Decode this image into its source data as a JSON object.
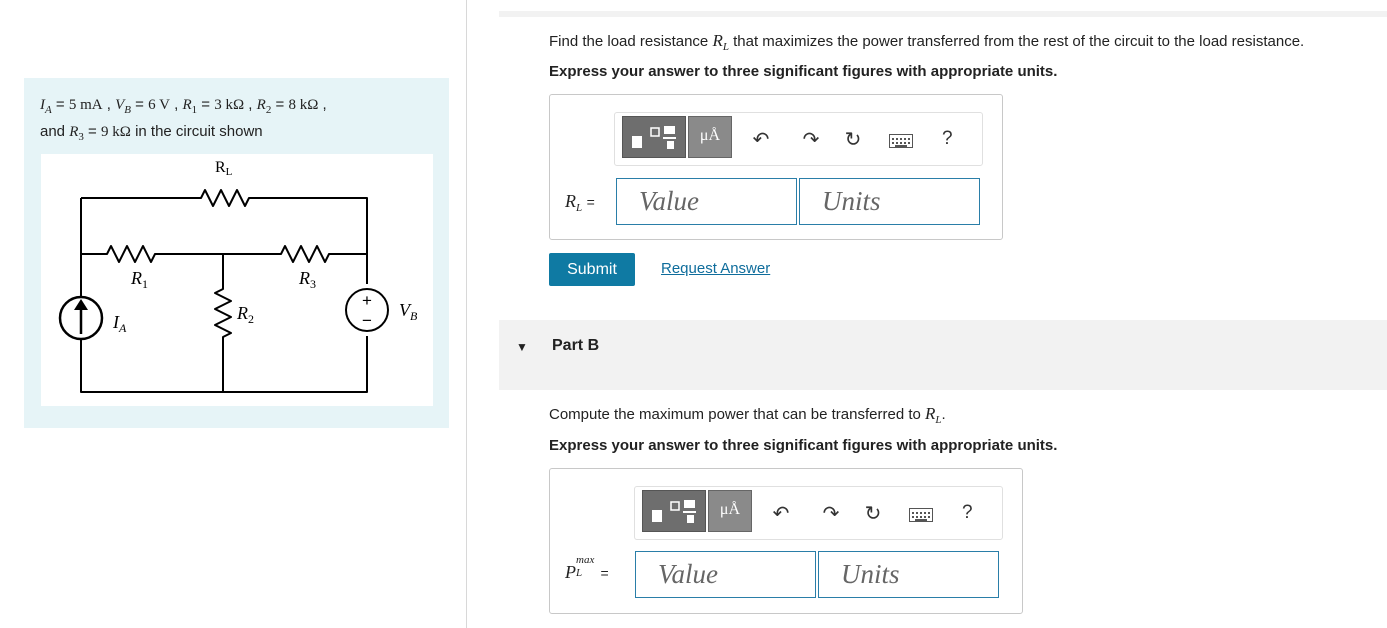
{
  "problem": {
    "given_line1": "I_A = 5 mA , V_B = 6 V , R_1 = 3 kΩ , R_2 = 8 kΩ ,",
    "given_line2": "and R_3 = 9 kΩ in the circuit shown",
    "parts": {
      "IA": "I",
      "IA_sub": "A",
      "IA_val": "5 mA",
      "VB": "V",
      "VB_sub": "B",
      "VB_val": "6 V",
      "R1": "R",
      "R1_sub": "1",
      "R1_val": "3 kΩ",
      "R2": "R",
      "R2_sub": "2",
      "R2_val": "8 kΩ",
      "R3": "R",
      "R3_sub": "3",
      "R3_val": "9 kΩ",
      "and": "and",
      "tail": "in the circuit shown"
    },
    "circuit_labels": {
      "RL": "R",
      "RL_sub": "L",
      "R1": "R",
      "R1_sub": "1",
      "R3": "R",
      "R3_sub": "3",
      "R2": "R",
      "R2_sub": "2",
      "IA": "I",
      "IA_sub": "A",
      "VB": "V",
      "VB_sub": "B",
      "plus": "+",
      "minus": "−"
    }
  },
  "part_a": {
    "question_pre": "Find the load resistance",
    "question_var": "R",
    "question_sub": "L",
    "question_post": "that maximizes the power transferred from the rest of the circuit to the load resistance.",
    "instruction": "Express your answer to three significant figures with appropriate units.",
    "var_label": "R",
    "var_sub": "L",
    "eq": "=",
    "value_placeholder": "Value",
    "units_placeholder": "Units",
    "submit_label": "Submit",
    "request_label": "Request Answer"
  },
  "part_b": {
    "title": "Part B",
    "question_pre": "Compute the maximum power that can be transferred to",
    "question_var": "R",
    "question_sub": "L",
    "question_post": ".",
    "instruction": "Express your answer to three significant figures with appropriate units.",
    "var_label": "P",
    "var_sup": "max",
    "var_sub": "L",
    "eq": "=",
    "value_placeholder": "Value",
    "units_placeholder": "Units"
  },
  "toolbar": {
    "units_button": "μÅ",
    "help": "?",
    "icons": [
      "templates-icon",
      "units-icon",
      "undo-icon",
      "redo-icon",
      "reset-icon",
      "keyboard-icon",
      "help-icon"
    ]
  },
  "colors": {
    "accent": "#0f7aa3",
    "panel": "#e6f4f7",
    "field_border": "#2a7ea8"
  }
}
